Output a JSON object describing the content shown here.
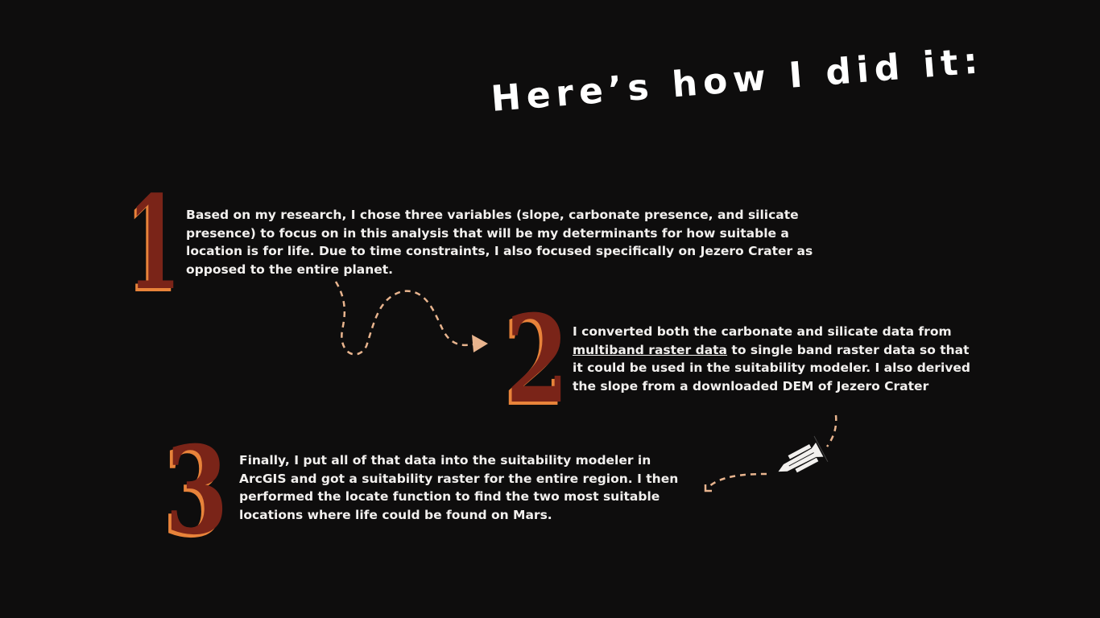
{
  "title": "Here’s how I did it:",
  "steps": [
    {
      "number": "1",
      "text": "Based on my research, I chose three variables (slope, carbonate presence, and silicate presence) to focus on in this analysis that will be my determinants for how suitable a location is for life. Due to time constraints, I also focused specifically on Jezero Crater as opposed to the entire planet."
    },
    {
      "number": "2",
      "text_before": "I converted both the carbonate and silicate data from ",
      "link": "multiband raster data",
      "text_after": " to single band raster data so that it could be used in the suitability modeler. I also derived the slope from a downloaded DEM of Jezero Crater"
    },
    {
      "number": "3",
      "text": "Finally, I put all of that data into the suitability modeler in ArcGIS and got a suitability raster for the entire region. I then performed the locate function to find the two most suitable locations where life could be found on Mars."
    }
  ],
  "colors": {
    "background": "#0e0d0d",
    "number": "#7a2418",
    "number_shadow": "#e8833a",
    "arrow": "#e8b48e"
  }
}
